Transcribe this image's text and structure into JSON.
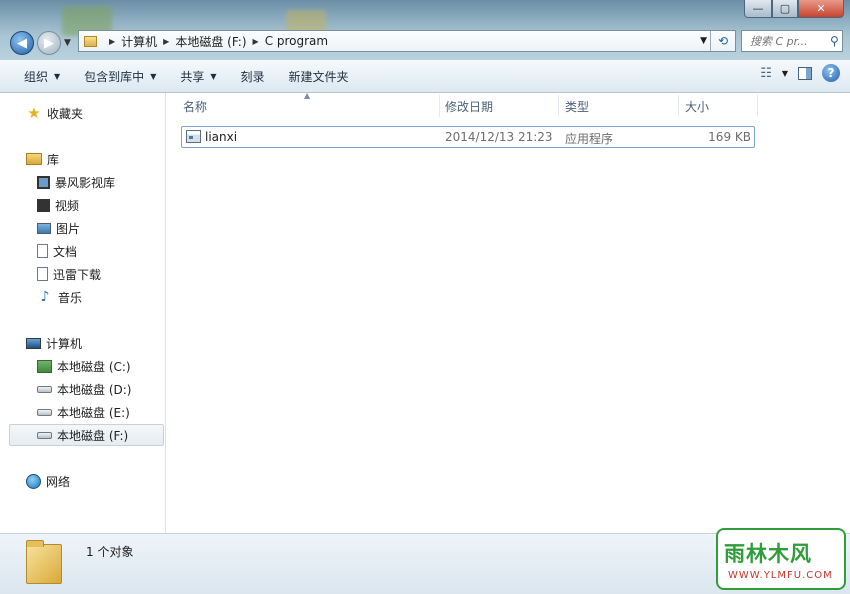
{
  "window": {
    "controls": {
      "minimize": "—",
      "maximize": "▢",
      "close": "✕"
    }
  },
  "address": {
    "crumbs": [
      "计算机",
      "本地磁盘 (F:)",
      "C program"
    ]
  },
  "search": {
    "placeholder": "搜索 C pr..."
  },
  "toolbar": {
    "organize": "组织",
    "include_in_library": "包含到库中",
    "share": "共享",
    "burn": "刻录",
    "new_folder": "新建文件夹"
  },
  "sidebar": {
    "favorites": "收藏夹",
    "libraries": "库",
    "library_items": [
      "暴风影视库",
      "视频",
      "图片",
      "文档",
      "迅雷下载",
      "音乐"
    ],
    "computer": "计算机",
    "drives": [
      "本地磁盘 (C:)",
      "本地磁盘 (D:)",
      "本地磁盘 (E:)",
      "本地磁盘 (F:)"
    ],
    "network": "网络"
  },
  "columns": {
    "name": "名称",
    "date": "修改日期",
    "type": "类型",
    "size": "大小"
  },
  "files": [
    {
      "name": "lianxi",
      "date": "2014/12/13 21:23",
      "type": "应用程序",
      "size": "169 KB"
    }
  ],
  "status": {
    "count_text": "1 个对象"
  },
  "watermark": {
    "line1": "雨林木风",
    "line2": "WWW.YLMFU.COM"
  }
}
